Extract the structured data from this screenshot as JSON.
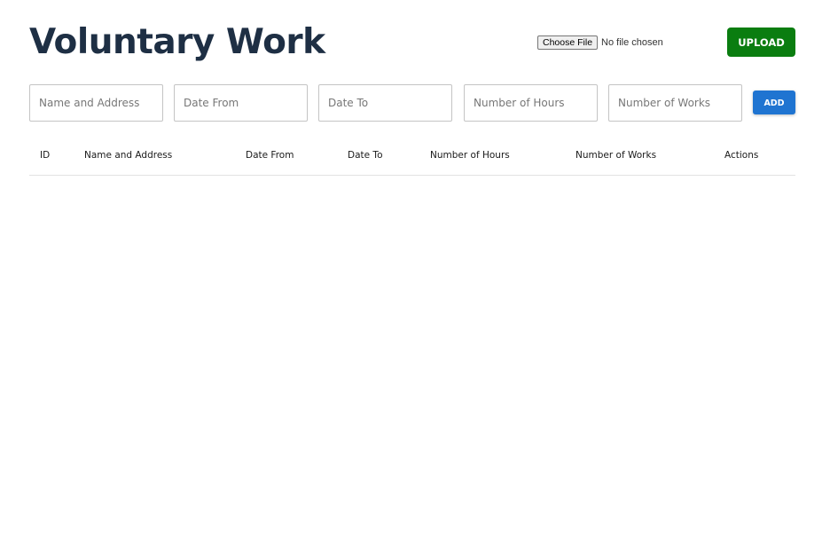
{
  "header": {
    "title": "Voluntary Work"
  },
  "file_upload": {
    "choose_label": "Choose File",
    "status": "No file chosen",
    "upload_label": "UPLOAD"
  },
  "form": {
    "name_address_placeholder": "Name and Address",
    "date_from_placeholder": "Date From",
    "date_to_placeholder": "Date To",
    "hours_placeholder": "Number of Hours",
    "works_placeholder": "Number of Works",
    "add_label": "ADD"
  },
  "table": {
    "columns": [
      "ID",
      "Name and Address",
      "Date From",
      "Date To",
      "Number of Hours",
      "Number of Works",
      "Actions"
    ],
    "rows": []
  },
  "colors": {
    "title": "#1e2f44",
    "upload_button": "#0a7d10",
    "add_button": "#1f74d1"
  },
  "icons": []
}
